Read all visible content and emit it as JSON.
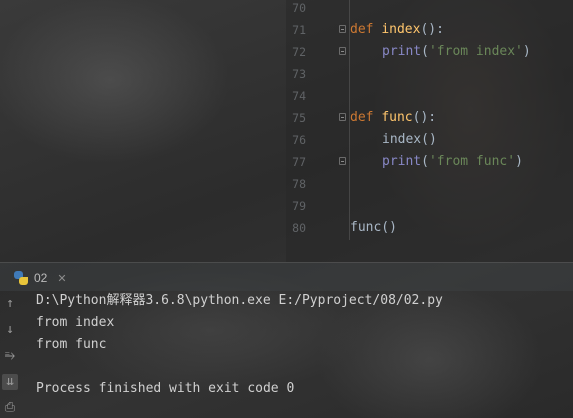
{
  "editor": {
    "lines": [
      {
        "num": "70",
        "kind": "blank"
      },
      {
        "num": "71",
        "kind": "def",
        "keyword": "def",
        "name": "index",
        "rest": "():"
      },
      {
        "num": "72",
        "kind": "print",
        "builtin": "print",
        "open": "(",
        "string": "'from index'",
        "close": ")"
      },
      {
        "num": "73",
        "kind": "blank"
      },
      {
        "num": "74",
        "kind": "blank"
      },
      {
        "num": "75",
        "kind": "def",
        "keyword": "def",
        "name": "func",
        "rest": "():"
      },
      {
        "num": "76",
        "kind": "call",
        "text": "index()"
      },
      {
        "num": "77",
        "kind": "print",
        "builtin": "print",
        "open": "(",
        "string": "'from func'",
        "close": ")"
      },
      {
        "num": "78",
        "kind": "blank"
      },
      {
        "num": "79",
        "kind": "blank"
      },
      {
        "num": "80",
        "kind": "top",
        "text": "func()"
      }
    ]
  },
  "run": {
    "tab_label": "02",
    "tab_icon": "python-icon",
    "output": [
      "D:\\Python解释器3.6.8\\python.exe E:/Pyproject/08/02.py",
      "from index",
      "from func",
      "",
      "Process finished with exit code 0"
    ],
    "toolbar": [
      "rerun-up-icon",
      "scroll-down-icon",
      "soft-wrap-icon",
      "scroll-to-end-icon",
      "print-icon"
    ]
  },
  "colors": {
    "keyword": "#cc7832",
    "function": "#ffc66d",
    "builtin": "#8888c6",
    "string": "#6a8759",
    "text": "#a9b7c6"
  }
}
